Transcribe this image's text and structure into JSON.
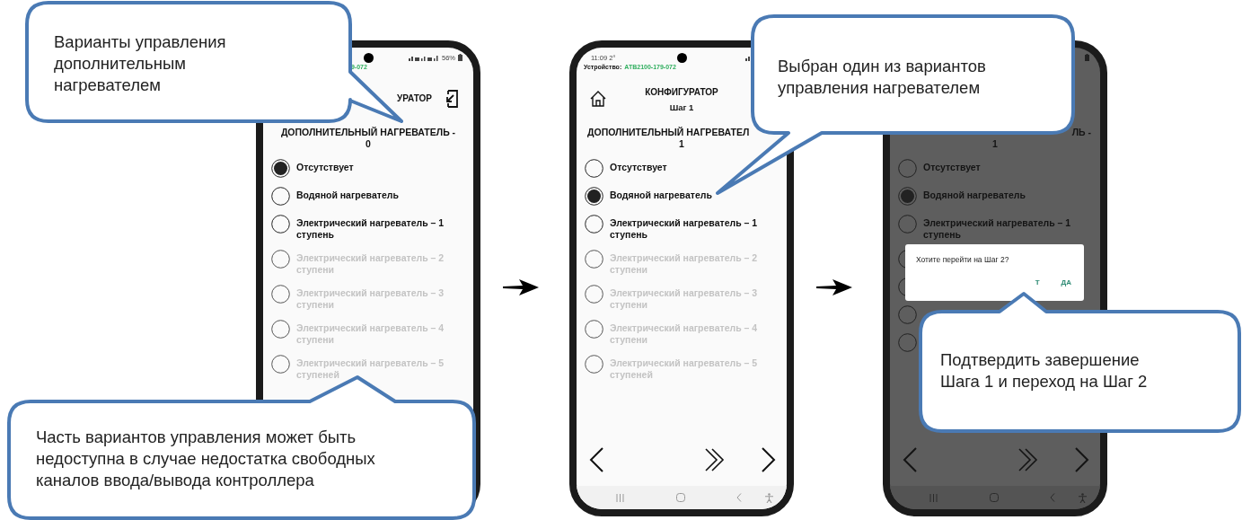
{
  "phones": [
    {
      "dimmed": false,
      "status": {
        "signal_icons": true,
        "battery_text": "56%",
        "battery_icon": true
      },
      "device": {
        "value": "9-072",
        "start_covered": true
      },
      "header": {
        "title": "УРАТОР",
        "title_start_covered": true,
        "exit_icon": true
      },
      "heading": [
        {
          "text": "ДОПОЛНИТЕЛЬНЫЙ НАГРЕВАТЕЛЬ -"
        },
        {
          "text": "0"
        }
      ],
      "options": [
        {
          "label": "Отсутствует",
          "selected": true,
          "disabled": false
        },
        {
          "label": "Водяной нагреватель",
          "selected": false,
          "disabled": false
        },
        {
          "label": "Электрический нагреватель – 1 ступень",
          "selected": false,
          "disabled": false
        },
        {
          "label": "Электрический нагреватель – 2 ступени",
          "selected": false,
          "disabled": true
        },
        {
          "label": "Электрический нагреватель – 3 ступени",
          "selected": false,
          "disabled": true
        },
        {
          "label": "Электрический нагреватель – 4 ступени",
          "selected": false,
          "disabled": true
        },
        {
          "label": "Электрический нагреватель – 5 ступеней",
          "selected": false,
          "disabled": true
        }
      ]
    },
    {
      "dimmed": false,
      "status": {
        "time": "11:09 2°",
        "signal_icons": true
      },
      "device": {
        "label": "Устройство:",
        "value": "АТВ2100-179-072"
      },
      "header": {
        "home_icon": true,
        "title": "КОНФИГУРАТОР",
        "step": "Шаг 1"
      },
      "heading": [
        {
          "text": "ДОПОЛНИТЕЛЬНЫЙ НАГРЕВАТЕЛ",
          "end_covered": true
        },
        {
          "text": "1"
        }
      ],
      "options": [
        {
          "label": "Отсутствует",
          "selected": false,
          "disabled": false
        },
        {
          "label": "Водяной нагреватель",
          "selected": true,
          "disabled": false
        },
        {
          "label": "Электрический нагреватель – 1 ступень",
          "selected": false,
          "disabled": false
        },
        {
          "label": "Электрический нагреватель – 2 ступени",
          "selected": false,
          "disabled": true
        },
        {
          "label": "Электрический нагреватель – 3 ступени",
          "selected": false,
          "disabled": true
        },
        {
          "label": "Электрический нагреватель – 4 ступени",
          "selected": false,
          "disabled": true
        },
        {
          "label": "Электрический нагреватель – 5 ступеней",
          "selected": false,
          "disabled": true
        }
      ],
      "nav": true,
      "system_nav": true
    },
    {
      "dimmed": true,
      "status": {
        "battery_icon": true
      },
      "heading": [
        {
          "text": "ЛЬ -",
          "start_covered": true
        },
        {
          "text": "1"
        }
      ],
      "options": [
        {
          "label": "Отсутствует",
          "selected": false,
          "disabled": false
        },
        {
          "label": "Водяной нагреватель",
          "selected": true,
          "disabled": false
        },
        {
          "label": "Электрический нагреватель – 1 ступень",
          "selected": false,
          "disabled": false
        },
        {
          "selected": false
        },
        {
          "selected": false
        },
        {
          "selected": false
        },
        {
          "selected": false
        }
      ],
      "nav": true,
      "system_nav": true,
      "dialog": {
        "message": "Хотите перейти на Шаг 2?",
        "buttons": [
          {
            "label": "Т"
          },
          {
            "label": "ДА"
          }
        ]
      }
    }
  ],
  "callouts": [
    {
      "text": "Варианты управления\nдополнительным\nнагревателем"
    },
    {
      "text": "Выбран один из вариантов\nуправления нагревателем"
    },
    {
      "text": "Часть вариантов управления может быть\nнедоступна в случае недостатка свободных\nканалов ввода/вывода контроллера"
    },
    {
      "text": "Подтвердить завершение\nШага 1 и переход на Шаг 2"
    }
  ]
}
